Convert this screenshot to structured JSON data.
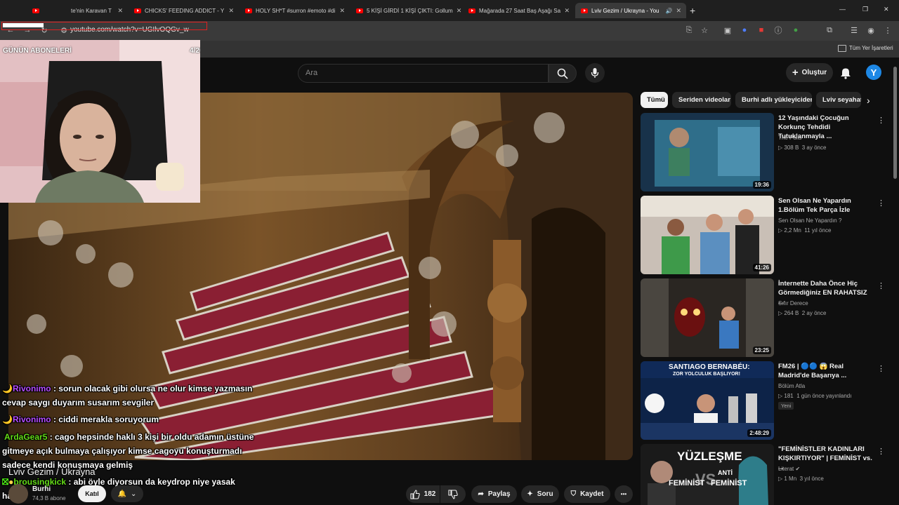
{
  "tabs": [
    {
      "label": "te'nin Karavan T",
      "active": false
    },
    {
      "label": "CHICKS' FEEDING ADDICT - Y",
      "active": false
    },
    {
      "label": "HOLY SH*T #surron #emoto #di",
      "active": false
    },
    {
      "label": "5 KİŞİ GİRDİ 1 KİŞİ ÇIKTI: Gollum",
      "active": false
    },
    {
      "label": "Mağarada 27 Saat Baş Aşağı Sa",
      "active": false
    },
    {
      "label": "Lviv Gezim / Ukrayna - You",
      "active": true
    }
  ],
  "new_tab": "+",
  "window_controls": [
    "—",
    "❐",
    "✕"
  ],
  "url": "youtube.com/watch?v=UGIlvOQGv_w",
  "bookmarks": {
    "all_bookmarks": "Tüm Yer İşaretleri"
  },
  "overlay": {
    "subscriber_title": "GÜNÜN ABONELERİ",
    "subscriber_count": "4/20"
  },
  "youtube": {
    "search_placeholder": "Ara",
    "create_label": "Oluştur",
    "avatar_letter": "Y"
  },
  "chat": [
    {
      "user": "Rivonimo",
      "text": " : sorun olacak gibi olursa ne olur kimse yazmasın",
      "badge": "moon"
    },
    {
      "user": "",
      "text": "cevap saygı duyarım susarım sevgiler",
      "badge": ""
    },
    {
      "user": "Rivonimo",
      "text": " : ciddi merakla soruyorum",
      "badge": "moon"
    },
    {
      "user": "ArdaGear5",
      "text": " : cago hepsinde haklı 3 kişi bir oldu adamın üstüne",
      "badge": ""
    },
    {
      "user": "",
      "text": "gitmeye açık bulmaya çalışıyor kimse cagoyu konuşturmadı",
      "badge": ""
    },
    {
      "user": "",
      "text": "sadece kendi konuşmaya gelmiş",
      "badge": ""
    },
    {
      "user": "brousingkick",
      "text": " : abi öyle diyorsun da keydrop niye yasak",
      "badge": "kick"
    },
    {
      "user": "",
      "text": "hala",
      "badge": ""
    }
  ],
  "video": {
    "title": "Lviv Gezim / Ukrayna",
    "channel": "Burhi",
    "subscribers": "74,3 B abone",
    "join_label": "Katıl",
    "likes": "182",
    "share_label": "Paylaş",
    "ask_label": "Soru",
    "save_label": "Kaydet",
    "more": "•••"
  },
  "chips": [
    "Tümü",
    "Seriden videolar",
    "Burhi adlı yükleyiciden",
    "Lviv seyahati"
  ],
  "recommendations": [
    {
      "title": "12 Yaşındaki Çocuğun Korkunç Tehdidi Tutuklanmayla ...",
      "channel": "The Polis",
      "views": "308 B",
      "age": "3 ay önce",
      "duration": "19:36",
      "badge": ""
    },
    {
      "title": "Sen Olsan Ne Yapardın  1.Bölüm Tek Parça İzle",
      "channel": "Sen Olsan Ne Yapardın ?",
      "views": "2,2 Mn",
      "age": "11 yıl önce",
      "duration": "41:26",
      "badge": ""
    },
    {
      "title": "İnternette Daha Önce Hiç Görmediğiniz EN RAHATSIZ ...",
      "channel": "Sıfır Derece",
      "views": "264 B",
      "age": "2 ay önce",
      "duration": "23:25",
      "badge": ""
    },
    {
      "title": "FM26 | 🔵🔵 😱 Real Madrid'de Başarıya ...",
      "channel": "Bölüm Atla",
      "views": "181",
      "age": "1 gün önce yayınlandı",
      "duration": "2:48:29",
      "badge": "Yeni"
    },
    {
      "title": "\"FEMİNİSTLER KADINLARI KIŞKIRTIYOR\" | FEMİNİST vs. ...",
      "channel": "Literat",
      "views": "1 Mn",
      "age": "3 yıl önce",
      "duration": "",
      "badge": ""
    }
  ],
  "thumb_text": {
    "santiago": "SANTIAGO BERNABÉU:",
    "santiago_sub": "ZOR YOLCULUK BAŞLIYOR!",
    "yuzlesme": "YÜZLEŞME",
    "vs": "VS",
    "anti": "ANTİ",
    "feminist_left": "FEMİNİST",
    "feminist_right": "FEMİNİST"
  }
}
